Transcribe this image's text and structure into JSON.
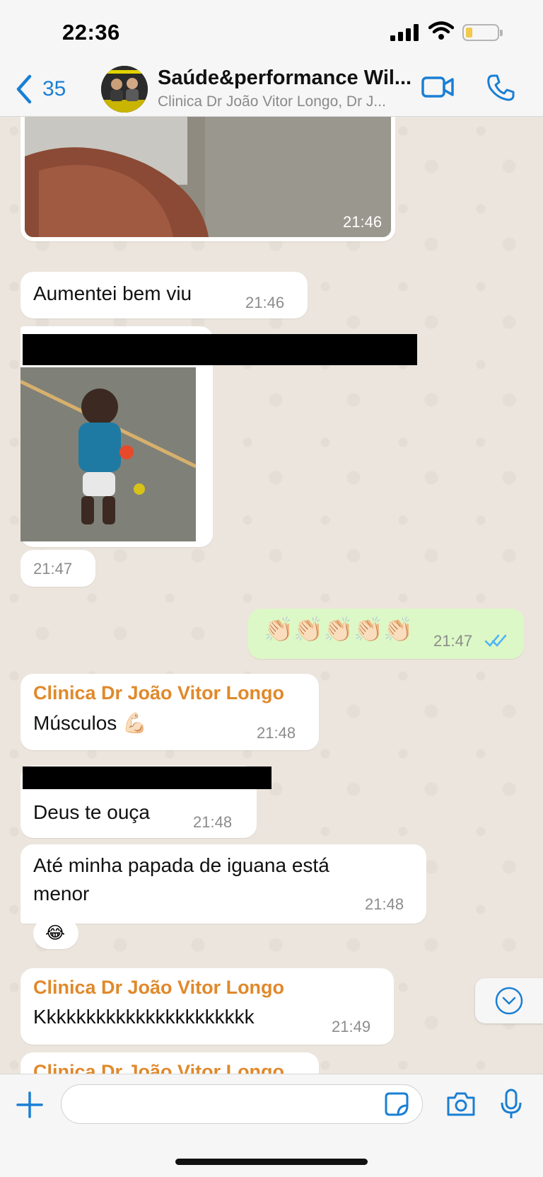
{
  "status": {
    "time": "22:36"
  },
  "header": {
    "back_count": "35",
    "title": "Saúde&performance Wil...",
    "subtitle": "Clinica Dr João Vitor Longo, Dr J..."
  },
  "messages": [
    {
      "kind": "image",
      "direction": "in",
      "time": "21:46"
    },
    {
      "kind": "text",
      "direction": "in",
      "text": "Aumentei bem viu",
      "time": "21:46"
    },
    {
      "kind": "image",
      "direction": "in",
      "time": "21:47"
    },
    {
      "kind": "text",
      "direction": "out",
      "text": "👏🏻👏🏻👏🏻👏🏻👏🏻",
      "time": "21:47",
      "status": "read"
    },
    {
      "kind": "text",
      "direction": "in",
      "sender": "Clinica Dr João Vitor Longo",
      "text": "Músculos 💪🏻",
      "time": "21:48"
    },
    {
      "kind": "text",
      "direction": "in",
      "text": "Deus te ouça",
      "time": "21:48"
    },
    {
      "kind": "text",
      "direction": "in",
      "line1": "Até minha papada de iguana está",
      "line2": "menor",
      "time": "21:48",
      "reaction": "😂"
    },
    {
      "kind": "text",
      "direction": "in",
      "sender": "Clinica Dr João Vitor Longo",
      "text": "Kkkkkkkkkkkkkkkkkkkkkk",
      "time": "21:49"
    },
    {
      "kind": "text",
      "direction": "in",
      "sender": "Clinica Dr João Vitor Longo"
    }
  ],
  "icons": {
    "back": "chevron-left-icon",
    "video": "video-camera-icon",
    "call": "phone-icon",
    "add": "plus-icon",
    "sticker": "sticker-icon",
    "camera": "camera-icon",
    "mic": "microphone-icon",
    "scroll": "chevron-down-icon",
    "read": "double-check-icon"
  },
  "colors": {
    "accent": "#1a7fd4",
    "sender_name": "#e0892b",
    "outgoing_bubble": "#dcf8c6",
    "read_ticks": "#4fb3f6"
  }
}
